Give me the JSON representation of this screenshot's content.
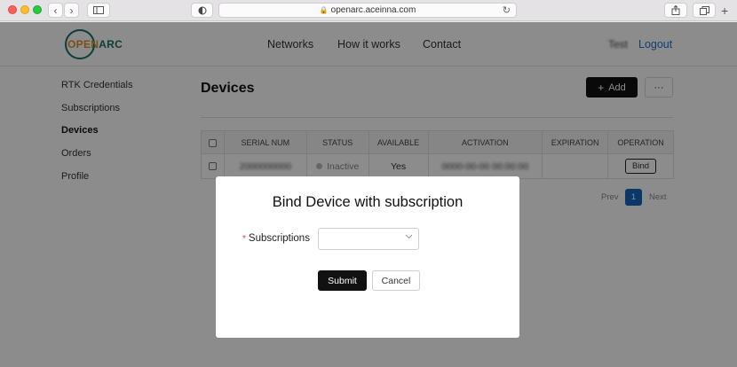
{
  "browser": {
    "url": "openarc.aceinna.com",
    "back_icon": "chevron-left-icon",
    "forward_icon": "chevron-right-icon"
  },
  "header": {
    "logo_text_o": "OPEN",
    "logo_text_rest": "ARC",
    "nav": [
      "Networks",
      "How it works",
      "Contact"
    ],
    "user": "Test",
    "logout": "Logout"
  },
  "sidebar": {
    "items": [
      {
        "label": "RTK Credentials"
      },
      {
        "label": "Subscriptions"
      },
      {
        "label": "Devices",
        "active": true
      },
      {
        "label": "Orders"
      },
      {
        "label": "Profile"
      }
    ]
  },
  "main": {
    "title": "Devices",
    "add_label": "Add",
    "more_label": "···",
    "table": {
      "columns": [
        "SERIAL NUM",
        "STATUS",
        "AVAILABLE",
        "ACTIVATION",
        "EXPIRATION",
        "OPERATION"
      ],
      "rows": [
        {
          "serial": "2000000000",
          "status": "Inactive",
          "available": "Yes",
          "activation": "0000-00-00 00:00:00",
          "expiration": "",
          "operation": "Bind"
        }
      ]
    },
    "pagination": {
      "prev": "Prev",
      "page": "1",
      "next": "Next"
    }
  },
  "modal": {
    "title": "Bind Device with subscription",
    "required_mark": "*",
    "field_label": "Subscriptions",
    "select_value": "",
    "submit": "Submit",
    "cancel": "Cancel"
  },
  "colors": {
    "accent": "#1976d2",
    "brand_green": "#1c6f64",
    "brand_orange": "#e08f27",
    "page_button": "#1565c0"
  }
}
